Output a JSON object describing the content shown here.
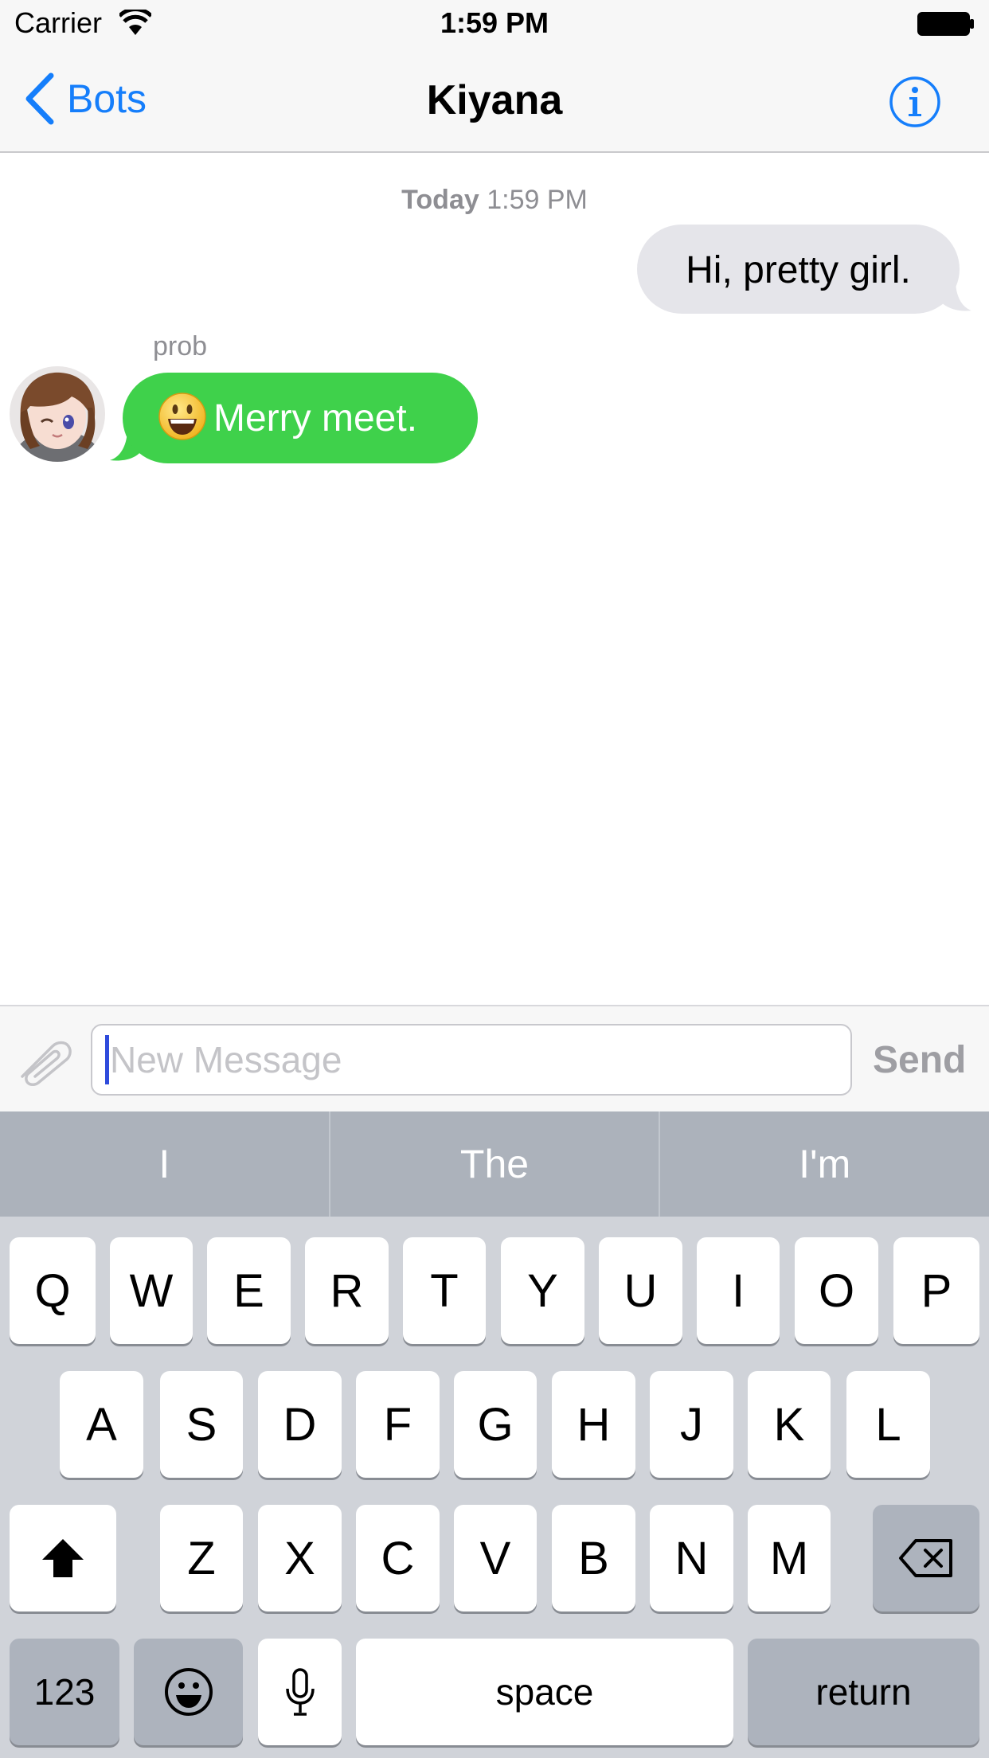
{
  "status_bar": {
    "carrier": "Carrier",
    "time": "1:59 PM",
    "icons": [
      "wifi-icon",
      "battery-icon"
    ]
  },
  "nav": {
    "back_label": "Bots",
    "title": "Kiyana",
    "info_icon": "info-icon",
    "accent_color": "#157efb"
  },
  "chat": {
    "timestamp_day": "Today",
    "timestamp_time": "1:59 PM",
    "messages": [
      {
        "direction": "outgoing",
        "text": "Hi, pretty girl."
      },
      {
        "direction": "incoming",
        "sender": "prob",
        "emoji": "smiley-emoji",
        "text": "Merry meet."
      }
    ],
    "incoming_color": "#3fd14b",
    "outgoing_color": "#e5e5ea"
  },
  "composer": {
    "attach_icon": "paperclip-icon",
    "placeholder": "New Message",
    "value": "",
    "send_label": "Send"
  },
  "keyboard": {
    "suggestions": [
      "I",
      "The",
      "I'm"
    ],
    "row1": [
      "Q",
      "W",
      "E",
      "R",
      "T",
      "Y",
      "U",
      "I",
      "O",
      "P"
    ],
    "row2": [
      "A",
      "S",
      "D",
      "F",
      "G",
      "H",
      "J",
      "K",
      "L"
    ],
    "row3": [
      "Z",
      "X",
      "C",
      "V",
      "B",
      "N",
      "M"
    ],
    "numbers_label": "123",
    "space_label": "space",
    "return_label": "return",
    "shift_icon": "shift-icon",
    "delete_icon": "backspace-icon",
    "emoji_icon": "emoji-icon",
    "mic_icon": "microphone-icon"
  }
}
